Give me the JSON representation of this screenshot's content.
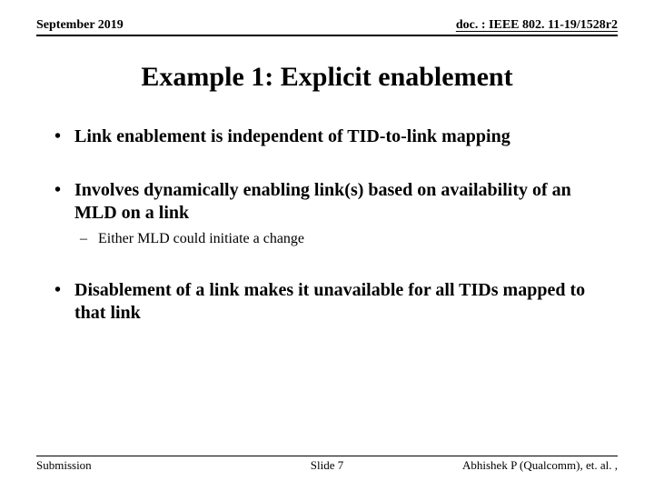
{
  "header": {
    "date": "September 2019",
    "doc_id": "doc. : IEEE 802. 11-19/1528r2"
  },
  "title": "Example 1: Explicit enablement",
  "bullets": [
    {
      "text": "Link enablement is independent of TID-to-link mapping"
    },
    {
      "text": "Involves dynamically enabling link(s) based on availability of an MLD on a link",
      "sub": "Either MLD could initiate a change"
    },
    {
      "text": "Disablement of a link makes it unavailable for all TIDs mapped to that link"
    }
  ],
  "footer": {
    "left": "Submission",
    "center": "Slide 7",
    "right": "Abhishek P (Qualcomm), et. al. ,"
  }
}
